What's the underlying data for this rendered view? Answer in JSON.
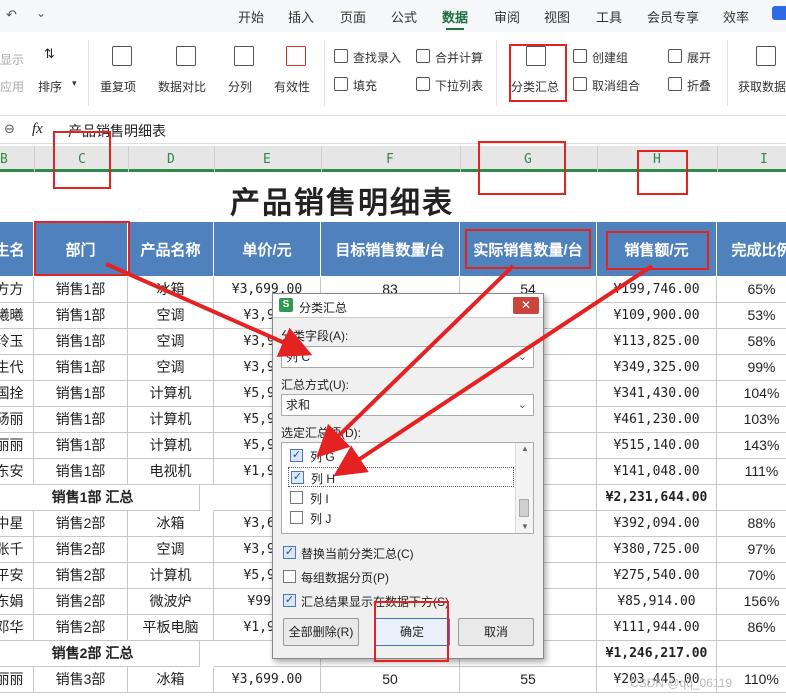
{
  "menu": [
    "开始",
    "插入",
    "页面",
    "公式",
    "数据",
    "审阅",
    "视图",
    "工具",
    "会员专享",
    "效率"
  ],
  "ribbon": {
    "show": "显示",
    "apply": "应用",
    "sort": "排序",
    "dup": "重复项",
    "compare": "数据对比",
    "split": "分列",
    "validity": "有效性",
    "find_entry": "查找录入",
    "fill": "填充",
    "merge_calc": "合并计算",
    "dropdown_list": "下拉列表",
    "subtotal": "分类汇总",
    "create_group": "创建组",
    "ungroup": "取消组合",
    "expand": "展开",
    "collapse": "折叠",
    "get_data": "获取数据"
  },
  "formula": {
    "fx": "fx",
    "value": "产品销售明细表"
  },
  "columns": [
    "B",
    "C",
    "D",
    "E",
    "F",
    "G",
    "H",
    "I"
  ],
  "title": "产品销售明细表",
  "headers": [
    "生名",
    "部门",
    "产品名称",
    "单价/元",
    "目标销售数量/台",
    "实际销售数量/台",
    "销售额/元",
    "完成比例"
  ],
  "rows": [
    [
      "方方",
      "销售1部",
      "冰箱",
      "¥3,699.00",
      "83",
      "54",
      "¥199,746.00",
      "65%"
    ],
    [
      "曦曦",
      "销售1部",
      "空调",
      "¥3,925",
      "",
      "",
      "¥109,900.00",
      "53%"
    ],
    [
      "玲玉",
      "销售1部",
      "空调",
      "¥3,925",
      "",
      "",
      "¥113,825.00",
      "58%"
    ],
    [
      "生代",
      "销售1部",
      "空调",
      "¥3,925",
      "",
      "",
      "¥349,325.00",
      "99%"
    ],
    [
      "国拴",
      "销售1部",
      "计算机",
      "¥5,990",
      "",
      "",
      "¥341,430.00",
      "104%"
    ],
    [
      "砀丽",
      "销售1部",
      "计算机",
      "¥5,990",
      "",
      "",
      "¥461,230.00",
      "103%"
    ],
    [
      "丽丽",
      "销售1部",
      "计算机",
      "¥5,990",
      "",
      "",
      "¥515,140.00",
      "143%"
    ],
    [
      "东安",
      "销售1部",
      "电视机",
      "¥1,959",
      "",
      "",
      "¥141,048.00",
      "111%"
    ],
    [
      "销售1部 汇总",
      "",
      "",
      "",
      "",
      "",
      "¥2,231,644.00",
      ""
    ],
    [
      "中星",
      "销售2部",
      "冰箱",
      "¥3,699",
      "",
      "",
      "¥392,094.00",
      "88%"
    ],
    [
      "张千",
      "销售2部",
      "空调",
      "¥3,925",
      "",
      "",
      "¥380,725.00",
      "97%"
    ],
    [
      "平安",
      "销售2部",
      "计算机",
      "¥5,990",
      "",
      "",
      "¥275,540.00",
      "70%"
    ],
    [
      "东娟",
      "销售2部",
      "微波炉",
      "¥999.",
      "",
      "",
      "¥85,914.00",
      "156%"
    ],
    [
      "邓华",
      "销售2部",
      "平板电脑",
      "¥1,999",
      "",
      "",
      "¥111,944.00",
      "86%"
    ],
    [
      "销售2部 汇总",
      "",
      "",
      "",
      "",
      "501",
      "¥1,246,217.00",
      ""
    ],
    [
      "丽丽",
      "销售3部",
      "冰箱",
      "¥3,699.00",
      "50",
      "55",
      "¥203,445.00",
      "110%"
    ]
  ],
  "dialog": {
    "title": "分类汇总",
    "field_label": "分类字段(A):",
    "field_value": "列 C",
    "method_label": "汇总方式(U):",
    "method_value": "求和",
    "items_label": "选定汇总项(D):",
    "items": [
      {
        "label": "列 G",
        "checked": true
      },
      {
        "label": "列 H",
        "checked": true
      },
      {
        "label": "列 I",
        "checked": false
      },
      {
        "label": "列 J",
        "checked": false
      }
    ],
    "opt_replace": "替换当前分类汇总(C)",
    "opt_page": "每组数据分页(P)",
    "opt_below": "汇总结果显示在数据下方(S)",
    "btn_remove": "全部删除(R)",
    "btn_ok": "确定",
    "btn_cancel": "取消"
  },
  "watermark": "CSDN @qq_06119"
}
